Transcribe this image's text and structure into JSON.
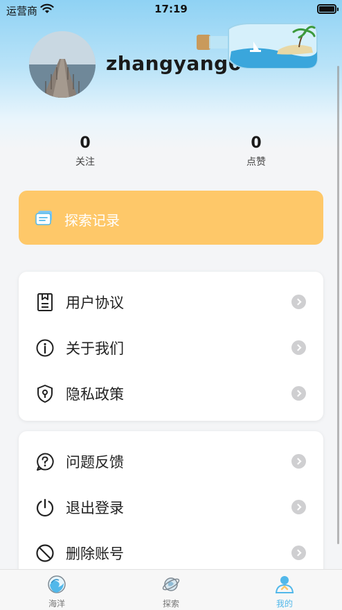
{
  "status_bar": {
    "carrier": "运营商",
    "time": "17:19"
  },
  "profile": {
    "username": "zhangyang0"
  },
  "stats": [
    {
      "value": "0",
      "label": "关注"
    },
    {
      "value": "0",
      "label": "点赞"
    }
  ],
  "explore": {
    "label": "探索记录",
    "color": "#fec869"
  },
  "menu_group_1": [
    {
      "label": "用户协议",
      "icon": "document-icon"
    },
    {
      "label": "关于我们",
      "icon": "info-icon"
    },
    {
      "label": "隐私政策",
      "icon": "shield-icon"
    }
  ],
  "menu_group_2": [
    {
      "label": "问题反馈",
      "icon": "question-bubble-icon"
    },
    {
      "label": "退出登录",
      "icon": "power-icon"
    },
    {
      "label": "删除账号",
      "icon": "prohibited-icon"
    }
  ],
  "tabs": [
    {
      "label": "海洋",
      "icon": "ocean-icon",
      "active": false
    },
    {
      "label": "探索",
      "icon": "planet-icon",
      "active": false
    },
    {
      "label": "我的",
      "icon": "profile-icon",
      "active": true
    }
  ],
  "colors": {
    "accent": "#52b8ea",
    "explore_bg": "#fec869"
  }
}
